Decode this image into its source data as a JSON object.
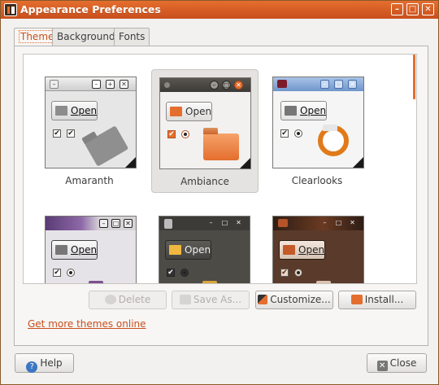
{
  "window": {
    "title": "Appearance Preferences",
    "accent_color": "#e46e2e",
    "controls": [
      "minimize",
      "maximize",
      "close"
    ]
  },
  "tabs": [
    {
      "label": "Theme",
      "active": true
    },
    {
      "label": "Background",
      "active": false
    },
    {
      "label": "Fonts",
      "active": false
    }
  ],
  "themes": [
    {
      "name": "Amaranth",
      "selected": false,
      "open_label": "Open",
      "check_mark": "✔",
      "folder_icon": "grey-folder-icon"
    },
    {
      "name": "Ambiance",
      "selected": true,
      "open_label": "Open",
      "check_mark": "✔",
      "folder_icon": "orange-folder-icon"
    },
    {
      "name": "Clearlooks",
      "selected": false,
      "open_label": "Open",
      "check_mark": "✔",
      "folder_icon": "ubuntu-logo-icon"
    },
    {
      "name": "",
      "selected": false,
      "open_label": "Open",
      "check_mark": "✔",
      "folder_icon": "purple-folder-icon"
    },
    {
      "name": "",
      "selected": false,
      "open_label": "Open",
      "check_mark": "✔",
      "folder_icon": "yellow-folder-icon"
    },
    {
      "name": "",
      "selected": false,
      "open_label": "Open",
      "check_mark": "✔",
      "folder_icon": "peach-folder-icon"
    }
  ],
  "actions": {
    "delete": "Delete",
    "save_as": "Save As...",
    "customize": "Customize...",
    "install": "Install..."
  },
  "more_link": "Get more themes online",
  "footer": {
    "help": "Help",
    "close": "Close"
  }
}
